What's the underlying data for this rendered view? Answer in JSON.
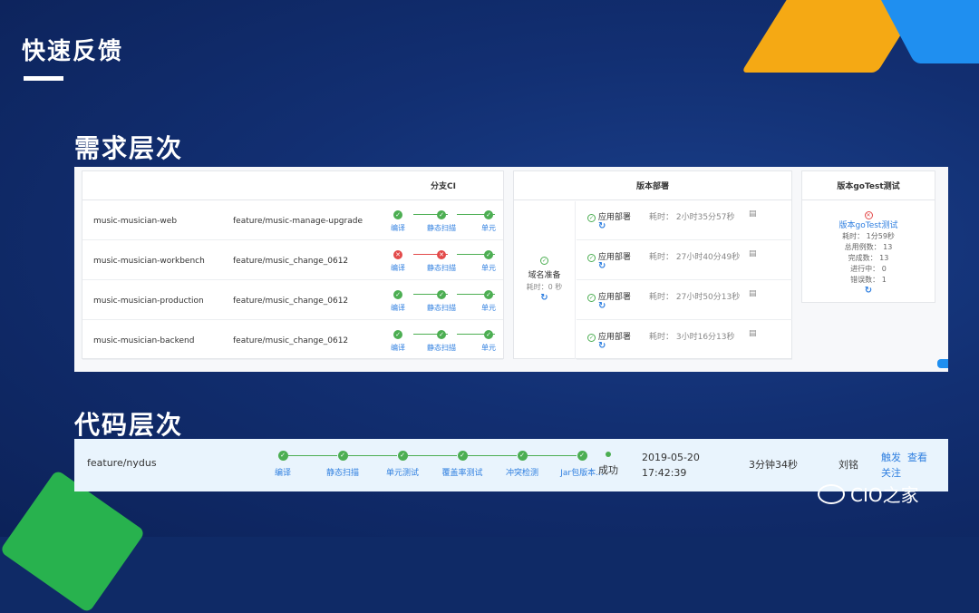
{
  "slide_title": "快速反馈",
  "section_req": "需求层次",
  "section_code": "代码层次",
  "branch_ci": {
    "header": "分支CI",
    "rows": [
      {
        "name": "music-musician-web",
        "branch": "feature/music-manage-upgrade",
        "statuses": [
          "ok",
          "ok",
          "ok"
        ]
      },
      {
        "name": "music-musician-workbench",
        "branch": "feature/music_change_0612",
        "statuses": [
          "fail",
          "fail",
          "ok"
        ]
      },
      {
        "name": "music-musician-production",
        "branch": "feature/music_change_0612",
        "statuses": [
          "ok",
          "ok",
          "ok"
        ]
      },
      {
        "name": "music-musician-backend",
        "branch": "feature/music_change_0612",
        "statuses": [
          "ok",
          "ok",
          "ok"
        ]
      }
    ],
    "steps": [
      "编译",
      "静态扫描",
      "单元"
    ]
  },
  "deploy": {
    "header": "版本部署",
    "left_label": "域名准备",
    "left_sub": "耗时：0 秒",
    "rows": [
      {
        "action": "应用部署",
        "duration": "耗时： 2小时35分57秒"
      },
      {
        "action": "应用部署",
        "duration": "耗时： 27小时40分49秒"
      },
      {
        "action": "应用部署",
        "duration": "耗时： 27小时50分13秒"
      },
      {
        "action": "应用部署",
        "duration": "耗时： 3小时16分13秒"
      }
    ]
  },
  "gotest": {
    "header": "版本goTest测试",
    "link": "版本goTest测试",
    "lines": [
      "耗时： 1分59秒",
      "总用例数： 13",
      "完成数： 13",
      "进行中： 0",
      "错误数： 1"
    ]
  },
  "code": {
    "branch": "feature/nydus",
    "steps": [
      "编译",
      "静态扫描",
      "单元测试",
      "覆盖率测试",
      "冲突检测",
      "Jar包版本..."
    ],
    "status": "成功",
    "date": "2019-05-20",
    "time": "17:42:39",
    "duration": "3分钟34秒",
    "user": "刘铭",
    "actions": [
      "触发",
      "查看",
      "关注"
    ]
  },
  "watermark": "CIO之家",
  "colors": {
    "ok": "#4cae52",
    "fail": "#e34a4a",
    "link": "#2f7fe0"
  }
}
